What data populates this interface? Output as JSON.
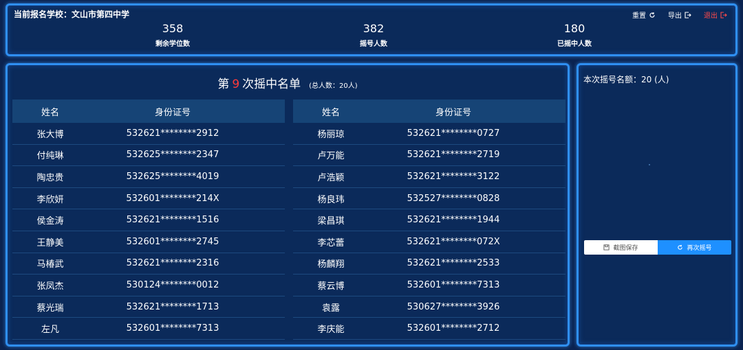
{
  "header": {
    "school": "当前报名学校：文山市第四中学",
    "actions": {
      "reset": "重置",
      "export": "导出",
      "logout": "退出"
    },
    "stats": [
      {
        "value": "358",
        "label": "剩余学位数"
      },
      {
        "value": "382",
        "label": "摇号人数"
      },
      {
        "value": "180",
        "label": "已摇中人数"
      }
    ]
  },
  "list": {
    "title_prefix": "第",
    "round": "9",
    "title_suffix": "次摇中名单",
    "total": "(总人数：20人)",
    "col_name": "姓名",
    "col_id": "身份证号",
    "left": [
      {
        "name": "张大博",
        "id": "532621********2912"
      },
      {
        "name": "付纯琳",
        "id": "532625********2347"
      },
      {
        "name": "陶忠贵",
        "id": "532625********4019"
      },
      {
        "name": "李欣妍",
        "id": "532601********214X"
      },
      {
        "name": "侯金涛",
        "id": "532621********1516"
      },
      {
        "name": "王静美",
        "id": "532601********2745"
      },
      {
        "name": "马椿武",
        "id": "532621********2316"
      },
      {
        "name": "张凤杰",
        "id": "530124********0012"
      },
      {
        "name": "蔡光瑞",
        "id": "532621********1713"
      },
      {
        "name": "左凡",
        "id": "532601********7313"
      }
    ],
    "right": [
      {
        "name": "杨丽琼",
        "id": "532621********0727"
      },
      {
        "name": "卢万能",
        "id": "532621********2719"
      },
      {
        "name": "卢浩颖",
        "id": "532621********3122"
      },
      {
        "name": "杨良玮",
        "id": "532527********0828"
      },
      {
        "name": "梁昌琪",
        "id": "532621********1944"
      },
      {
        "name": "李芯蕾",
        "id": "532621********072X"
      },
      {
        "name": "杨麟翔",
        "id": "532621********2533"
      },
      {
        "name": "蔡云博",
        "id": "532601********7313"
      },
      {
        "name": "袁露",
        "id": "530627********3926"
      },
      {
        "name": "李庆能",
        "id": "532601********2712"
      }
    ]
  },
  "side": {
    "quota": "本次摇号名额：20 (人)",
    "save_label": "截图保存",
    "again_label": "再次摇号"
  },
  "colors": {
    "accent": "#1e90ff",
    "border": "#2f8ff2",
    "highlight": "#ff3b3b",
    "bg": "#0b2350"
  }
}
